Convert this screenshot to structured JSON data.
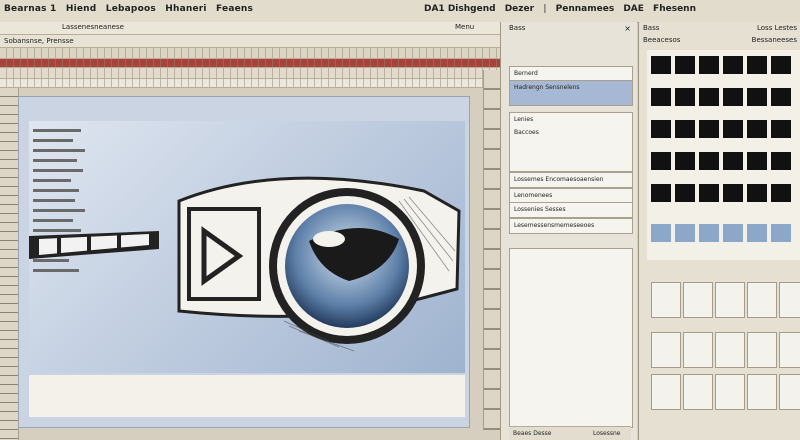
{
  "menubar": {
    "left_items": [
      "Bearnas 1",
      "Hiend",
      "Lebapoos",
      "Hhaneri",
      "Feaens"
    ],
    "right_items": [
      "DA1 Dishgend",
      "Dezer",
      "|",
      "Pennamees",
      "DAE",
      "Fhesenn"
    ]
  },
  "toolbar": {
    "row1_label": "Lassenesneanese",
    "row1_right": "Menu",
    "row2_label": "Sobansnse, Prensse"
  },
  "panel": {
    "title": "Bass",
    "close": "×",
    "item1": "Bernerd",
    "item2": "Hadrengn Sensnelens",
    "item3_title": "Lenies",
    "item3_sub": "Baccoes",
    "item4": "Lossemes Encomaesoaensien",
    "item5": "Lenomenees",
    "item6": "Lossenies Sesses",
    "item7": "Lesemessensmemeseeoes",
    "status_left": "Beaes Desse",
    "status_right": "Losessne"
  },
  "thumbs": {
    "hdr1": "Bass",
    "hdr2": "Beeacesos",
    "hdr_r1": "Loss Lestes",
    "hdr_r2": "Bessaneeses"
  },
  "colors": {
    "accent_red": "#a9433a",
    "selected_blue": "#a7b8d4",
    "canvas_blue": "#9fb3cf"
  },
  "icons": [
    "magnifier-icon",
    "scroll-bar",
    "close-icon"
  ]
}
